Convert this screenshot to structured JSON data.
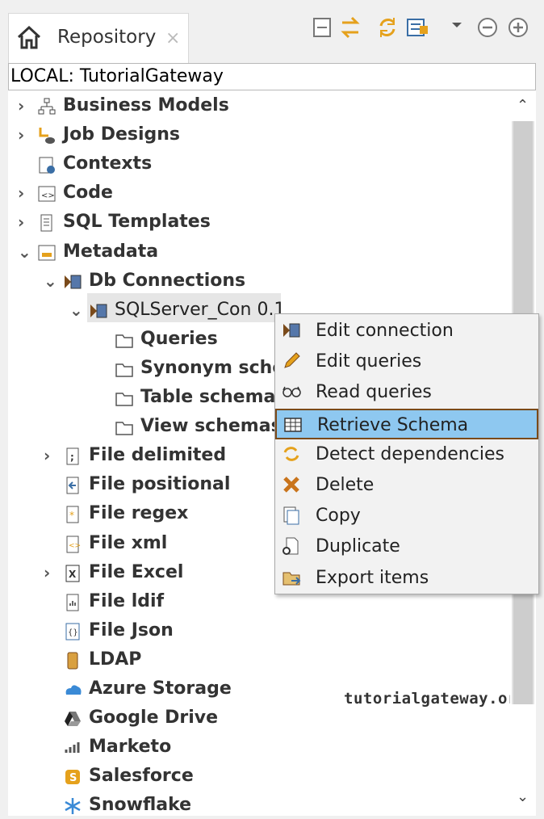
{
  "tab": {
    "title": "Repository",
    "close": "×"
  },
  "location": "LOCAL: TutorialGateway",
  "toolbar": [
    "collapse-icon",
    "sync-arrows-icon",
    "refresh-icon",
    "filter-icon",
    "menu-dropdown-icon",
    "minimize-icon",
    "maximize-icon"
  ],
  "tree": [
    {
      "label": "Business Models",
      "icon": "business-models-icon",
      "arrow": "›"
    },
    {
      "label": "Job Designs",
      "icon": "job-designs-icon",
      "arrow": "›"
    },
    {
      "label": "Contexts",
      "icon": "contexts-icon",
      "arrow": ""
    },
    {
      "label": "Code",
      "icon": "code-icon",
      "arrow": "›"
    },
    {
      "label": "SQL Templates",
      "icon": "sql-templates-icon",
      "arrow": "›"
    },
    {
      "label": "Metadata",
      "icon": "metadata-icon",
      "arrow": "⌄"
    },
    {
      "label": "Db Connections",
      "icon": "db-connections-icon",
      "arrow": "⌄"
    },
    {
      "label": "SQLServer_Con 0.1",
      "icon": "db-connection-icon",
      "arrow": "⌄"
    },
    {
      "label": "Queries",
      "icon": "folder-icon",
      "arrow": ""
    },
    {
      "label": "Synonym schemas",
      "icon": "folder-icon",
      "arrow": ""
    },
    {
      "label": "Table schemas",
      "icon": "folder-icon",
      "arrow": ""
    },
    {
      "label": "View schemas",
      "icon": "folder-icon",
      "arrow": ""
    },
    {
      "label": "File delimited",
      "icon": "file-delimited-icon",
      "arrow": "›"
    },
    {
      "label": "File positional",
      "icon": "file-positional-icon",
      "arrow": ""
    },
    {
      "label": "File regex",
      "icon": "file-regex-icon",
      "arrow": ""
    },
    {
      "label": "File xml",
      "icon": "file-xml-icon",
      "arrow": ""
    },
    {
      "label": "File Excel",
      "icon": "file-excel-icon",
      "arrow": "›"
    },
    {
      "label": "File ldif",
      "icon": "file-ldif-icon",
      "arrow": ""
    },
    {
      "label": "File Json",
      "icon": "file-json-icon",
      "arrow": ""
    },
    {
      "label": "LDAP",
      "icon": "ldap-icon",
      "arrow": ""
    },
    {
      "label": "Azure Storage",
      "icon": "azure-storage-icon",
      "arrow": ""
    },
    {
      "label": "Google Drive",
      "icon": "google-drive-icon",
      "arrow": ""
    },
    {
      "label": "Marketo",
      "icon": "marketo-icon",
      "arrow": ""
    },
    {
      "label": "Salesforce",
      "icon": "salesforce-icon",
      "arrow": ""
    },
    {
      "label": "Snowflake",
      "icon": "snowflake-icon",
      "arrow": ""
    }
  ],
  "context_menu": [
    {
      "label": "Edit connection",
      "icon": "db-connection-icon"
    },
    {
      "label": "Edit queries",
      "icon": "pencil-icon"
    },
    {
      "label": "Read queries",
      "icon": "glasses-icon"
    },
    {
      "label": "Retrieve Schema",
      "icon": "table-icon",
      "selected": true
    },
    {
      "label": "Detect dependencies",
      "icon": "dependencies-icon"
    },
    {
      "label": "Delete",
      "icon": "delete-icon"
    },
    {
      "label": "Copy",
      "icon": "copy-icon"
    },
    {
      "label": "Duplicate",
      "icon": "duplicate-icon"
    },
    {
      "label": "Export items",
      "icon": "export-icon"
    }
  ],
  "watermark": "tutorialgateway.org",
  "colors": {
    "selection": "#8ec8f0",
    "selection_border": "#7a4a1a",
    "tree_text": "#333333"
  }
}
